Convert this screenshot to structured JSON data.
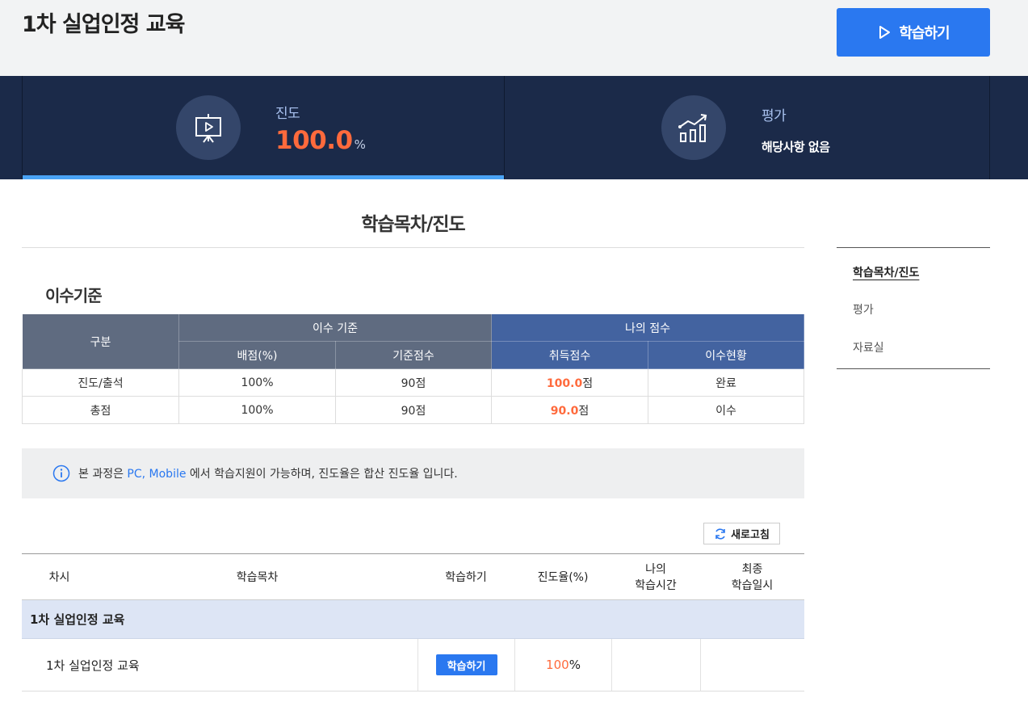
{
  "header": {
    "title": "1차 실업인정 교육",
    "study_button_label": "학습하기"
  },
  "stats": {
    "progress": {
      "label": "진도",
      "value": "100.0",
      "unit": "%",
      "icon": "presentation-icon"
    },
    "evaluation": {
      "label": "평가",
      "value": "해당사항 없음",
      "icon": "chart-growth-icon"
    }
  },
  "main": {
    "section_title": "학습목차/진도",
    "criteria_title": "이수기준",
    "criteria_table": {
      "col_group": "구분",
      "group_criteria": "이수 기준",
      "group_my_score": "나의 점수",
      "col_weight": "배점(%)",
      "col_base_score": "기준점수",
      "col_earned": "취득점수",
      "col_status": "이수현황",
      "rows": [
        {
          "name": "진도/출석",
          "weight": "100%",
          "base": "90점",
          "earned_num": "100.0",
          "earned_unit": "점",
          "status": "완료"
        },
        {
          "name": "총점",
          "weight": "100%",
          "base": "90점",
          "earned_num": "90.0",
          "earned_unit": "점",
          "status": "이수"
        }
      ]
    },
    "notice": {
      "icon": "info-icon",
      "prefix": "본 과정은 ",
      "highlight": "PC, Mobile",
      "suffix": " 에서 학습지원이 가능하며, 진도율은 합산 진도율 입니다."
    },
    "refresh_label": "새로고침",
    "list": {
      "headers": {
        "session": "차시",
        "contents": "학습목차",
        "study": "학습하기",
        "rate": "진도율(%)",
        "my_time_1": "나의",
        "my_time_2": "학습시간",
        "last_1": "최종",
        "last_2": "학습일시"
      },
      "group_title": "1차 실업인정 교육",
      "lesson": {
        "title": "1차 실업인정 교육",
        "study_label": "학습하기",
        "rate_num": "100",
        "rate_unit": "%"
      }
    }
  },
  "side_nav": {
    "items": [
      {
        "label": "학습목차/진도"
      },
      {
        "label": "평가"
      },
      {
        "label": "자료실"
      }
    ]
  },
  "colors": {
    "accent": "#2a78f0",
    "band": "#1b2a49",
    "highlight": "#ff6a3c"
  }
}
